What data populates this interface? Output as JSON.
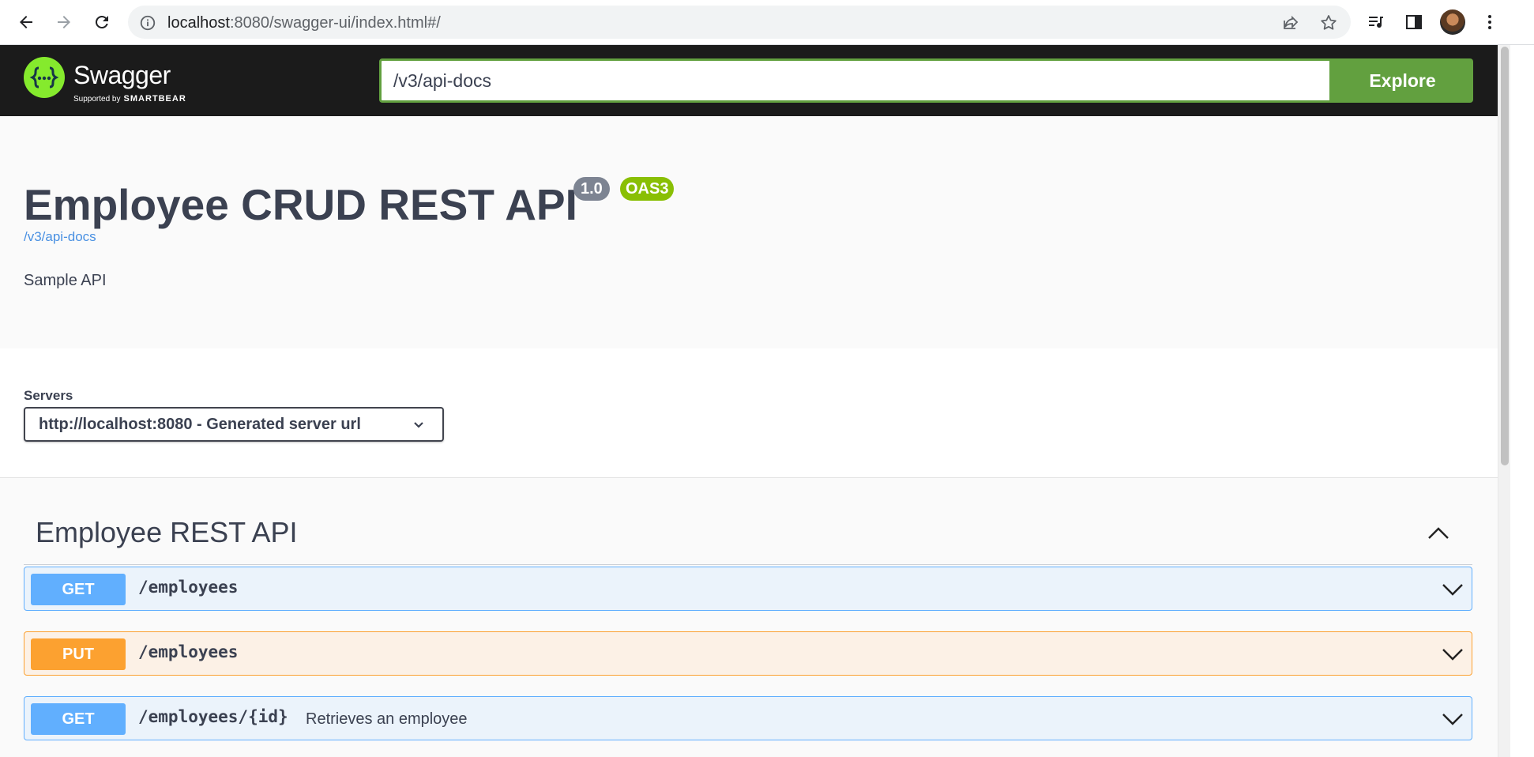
{
  "browser": {
    "url_host": "localhost",
    "url_rest": ":8080/swagger-ui/index.html#/"
  },
  "topbar": {
    "logo_text": "Swagger",
    "logo_supported": "Supported by",
    "logo_smartbear": "SMARTBEAR",
    "spec_url": "/v3/api-docs",
    "explore_label": "Explore",
    "colors": {
      "bar_bg": "#1b1b1b",
      "accent": "#62a03f",
      "logo": "#85ea2d"
    }
  },
  "info": {
    "title": "Employee CRUD REST API",
    "version": "1.0",
    "oas_badge": "OAS3",
    "docs_link": "/v3/api-docs",
    "description": "Sample API"
  },
  "servers": {
    "label": "Servers",
    "selected": "http://localhost:8080 - Generated server url"
  },
  "tag": {
    "name": "Employee REST API",
    "operations": [
      {
        "method": "GET",
        "path": "/employees",
        "summary": "",
        "color": "#61affe"
      },
      {
        "method": "PUT",
        "path": "/employees",
        "summary": "",
        "color": "#fca130"
      },
      {
        "method": "GET",
        "path": "/employees/{id}",
        "summary": "Retrieves an employee",
        "color": "#61affe"
      }
    ]
  }
}
